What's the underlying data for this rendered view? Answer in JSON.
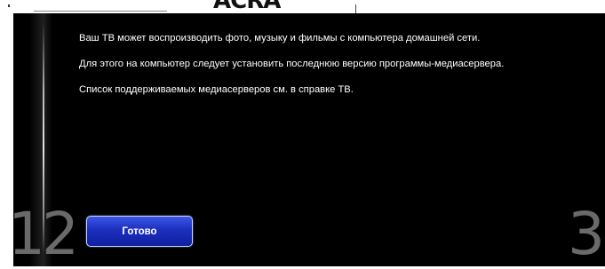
{
  "header_fragment": "ACRA",
  "step": {
    "previous": "12",
    "next": "3"
  },
  "message": {
    "lines": [
      "Ваш ТВ может воспроизводить фото, музыку и фильмы с компьютера домашней сети.",
      "Для этого на компьютер следует установить последнюю версию программы-медиасервера.",
      "Список поддерживаемых медиасерверов см. в справке ТВ."
    ]
  },
  "actions": {
    "done_label": "Готово"
  },
  "colors": {
    "background": "#000000",
    "text": "#ffffff",
    "step_number": "#6a6a6a",
    "button_top": "#3a56e6",
    "button_bottom": "#10209e",
    "button_border": "#c8d8ff"
  }
}
